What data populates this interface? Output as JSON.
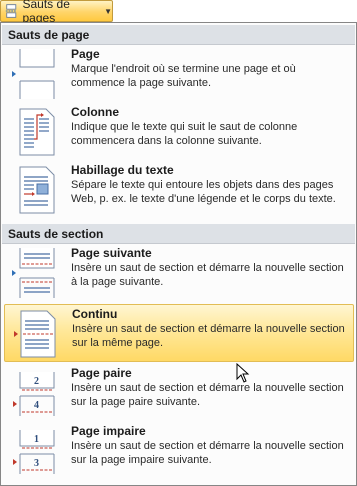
{
  "ribbon": {
    "label": "Sauts de pages"
  },
  "groups": {
    "page": {
      "header": "Sauts de page"
    },
    "section": {
      "header": "Sauts de section"
    }
  },
  "items": [
    {
      "title": "Page",
      "description": "Marque l'endroit où se termine une page et où commence la page suivante."
    },
    {
      "title": "Colonne",
      "description": "Indique que le texte qui suit le saut de colonne commencera dans la colonne suivante."
    },
    {
      "title": "Habillage du texte",
      "description": "Sépare le texte qui entoure les objets dans des pages Web, p. ex. le texte d'une légende et le corps du texte."
    },
    {
      "title": "Page suivante",
      "description": "Insère un saut de section et démarre la nouvelle section à la page suivante."
    },
    {
      "title": "Continu",
      "description": "Insère un saut de section et démarre la nouvelle section sur la même page.",
      "highlighted": true
    },
    {
      "title": "Page paire",
      "description": "Insère un saut de section et démarre la nouvelle section sur la page paire suivante."
    },
    {
      "title": "Page impaire",
      "description": "Insère un saut de section et démarre la nouvelle section sur la page impaire suivante."
    }
  ],
  "icon_numbers": {
    "even": [
      "2",
      "4"
    ],
    "odd": [
      "1",
      "3"
    ]
  },
  "colors": {
    "highlight": "#ffe89a",
    "header_bg": "#dde1e6",
    "accent_red": "#c0392b",
    "accent_blue": "#2f6fb6"
  }
}
